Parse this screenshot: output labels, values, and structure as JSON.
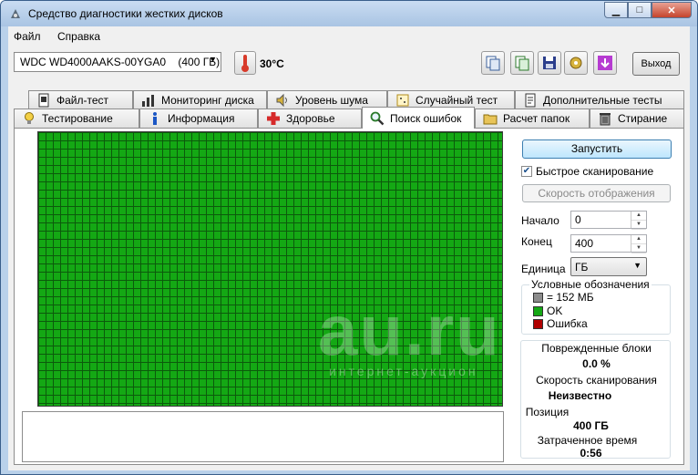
{
  "window": {
    "title": "Средство диагностики жестких дисков"
  },
  "menu": [
    {
      "label": "Файл"
    },
    {
      "label": "Справка"
    }
  ],
  "toolbar": {
    "drive": "WDC WD4000AAKS-00YGA0    (400 ГБ)",
    "temperature": "30°C",
    "exit_label": "Выход"
  },
  "tabs_back": [
    {
      "label": "Файл-тест"
    },
    {
      "label": "Мониторинг диска"
    },
    {
      "label": "Уровень шума"
    },
    {
      "label": "Случайный тест"
    },
    {
      "label": "Дополнительные тесты"
    }
  ],
  "tabs_front": [
    {
      "label": "Тестирование"
    },
    {
      "label": "Информация"
    },
    {
      "label": "Здоровье"
    },
    {
      "label": "Поиск ошибок",
      "active": true
    },
    {
      "label": "Расчет папок"
    },
    {
      "label": "Стирание"
    }
  ],
  "scan": {
    "start_label": "Запустить",
    "quick_scan_label": "Быстрое сканирование",
    "quick_scan_checked": true,
    "speed_label": "Скорость отображения",
    "start_field_label": "Начало",
    "start_value": "0",
    "end_field_label": "Конец",
    "end_value": "400",
    "unit_label": "Единица",
    "unit_value": "ГБ"
  },
  "legend": {
    "title": "Условные обозначения",
    "items": [
      {
        "label": "= 152 МБ",
        "color": "#8c8c8c"
      },
      {
        "label": "OK",
        "color": "#14a814"
      },
      {
        "label": "Ошибка",
        "color": "#b00000"
      }
    ]
  },
  "stats": {
    "damaged_label": "Поврежденные блоки",
    "damaged_value": "0.0 %",
    "speed_label": "Скорость сканирования",
    "speed_value": "Неизвестно",
    "position_label": "Позиция",
    "position_value": "400 ГБ",
    "elapsed_label": "Затраченное время",
    "elapsed_value": "0:56"
  },
  "colors": {
    "block_ok": "#14a814",
    "grid_line": "#0c5a0c",
    "window_frame": "#b9d1ea"
  },
  "watermark": {
    "main": "au.ru",
    "sub": "интернет-аукцион"
  }
}
